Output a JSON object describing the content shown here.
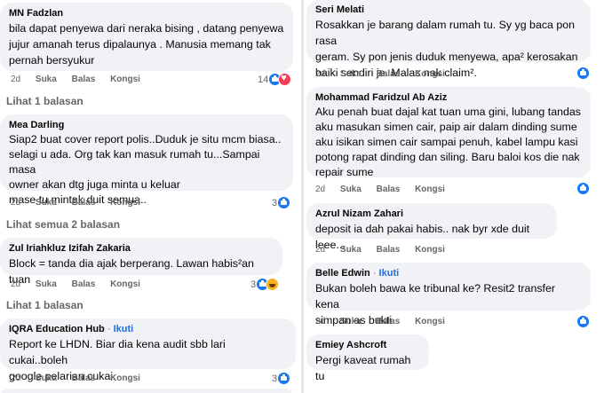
{
  "actions": {
    "time": "2d",
    "like": "Suka",
    "reply": "Balas",
    "share": "Kongsi"
  },
  "left": {
    "c1": {
      "author": "MN Fadzlan",
      "lines": [
        "bila dapat penyewa dari neraka bising , datang penyewa",
        "jujur amanah terus dipalaunya . Manusia memang tak",
        "pernah bersyukur"
      ],
      "reaction_count": "14",
      "reactions": [
        "like-icon",
        "love-icon"
      ]
    },
    "r1": "Lihat 1 balasan",
    "c2": {
      "author": "Mea Darling",
      "lines": [
        "Siap2 buat cover report polis..Duduk je situ mcm biasa..",
        "selagi u ada. Org tak kan masuk rumah tu...Sampai masa",
        "owner akan dtg juga minta u keluar",
        "mase tu mintak duit semua.."
      ],
      "reaction_count": "3",
      "reactions": [
        "like-icon"
      ]
    },
    "r2": "Lihat semua 2 balasan",
    "c3": {
      "author": "Zul Iriahkluz Izifah Zakaria",
      "lines": [
        "Block = tanda dia ajak berperang. Lawan habis²an tuan"
      ],
      "reaction_count": "3",
      "reactions": [
        "like-icon",
        "haha-icon"
      ]
    },
    "r3": "Lihat 1 balasan",
    "c4": {
      "author": "IQRA Education Hub",
      "follow": "Ikuti",
      "lines": [
        "Report ke LHDN. Biar dia kena audit sbb lari cukai..boleh",
        "google pelarian cukai."
      ],
      "reaction_count": "3",
      "reactions": [
        "like-icon"
      ]
    }
  },
  "right": {
    "c1": {
      "author": "Seri Melati",
      "lines": [
        "Rosakkan je barang dalam rumah tu. Sy yg baca pon rasa",
        "geram. Sy pon jenis duduk menyewa, apa² kerosakan",
        "baiki sendiri je. Malas nak claim²."
      ],
      "reactions": [
        "like-icon"
      ]
    },
    "c2": {
      "author": "Mohammad Faridzul Ab Aziz",
      "lines": [
        "Aku penah buat dajal kat tuan uma gini, lubang tandas",
        "aku masukan simen cair, paip air dalam dinding sume",
        "aku isikan simen cair sampai penuh, kabel lampu kasi",
        "potong rapat dinding dan siling. Baru baloi kos die nak",
        "repair sume"
      ],
      "reactions": [
        "like-icon"
      ]
    },
    "c3": {
      "author": "Azrul Nizam Zahari",
      "lines": [
        "deposit ia dah pakai habis.. nak byr xde duit leee..."
      ]
    },
    "c4": {
      "author": "Belle Edwin",
      "follow": "Ikuti",
      "lines": [
        "Bukan boleh bawa ke tribunal ke? Resit2 transfer kena",
        "simpan as bukti"
      ],
      "reactions": [
        "like-icon"
      ]
    },
    "c5": {
      "author": "Emiey Ashcroft",
      "lines": [
        "Pergi kaveat rumah tu"
      ]
    }
  }
}
